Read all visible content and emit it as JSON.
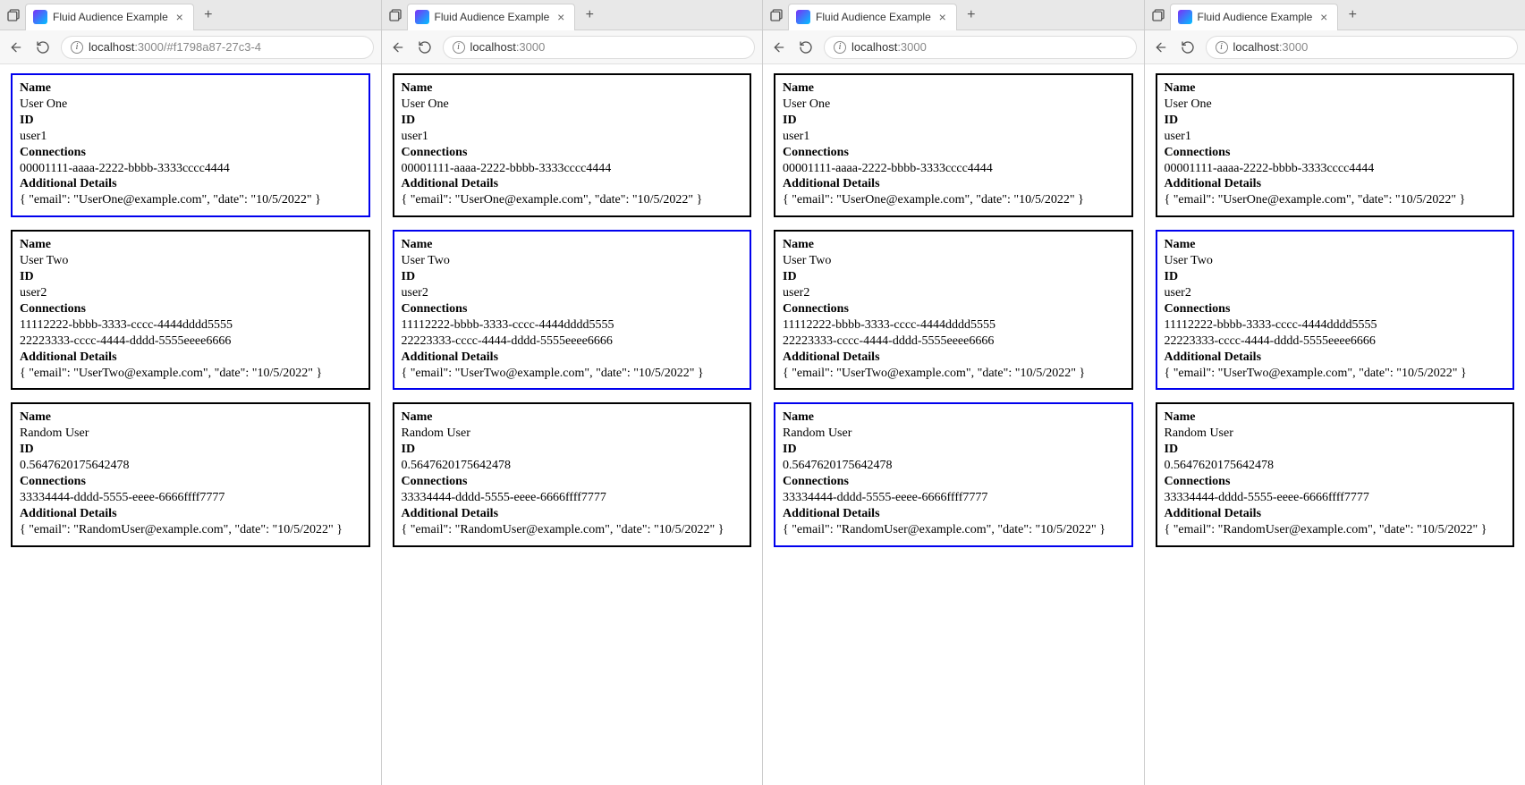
{
  "labels": {
    "name": "Name",
    "id": "ID",
    "connections": "Connections",
    "details": "Additional Details"
  },
  "users": [
    {
      "name": "User One",
      "id": "user1",
      "connections": [
        "00001111-aaaa-2222-bbbb-3333cccc4444"
      ],
      "details": "{ \"email\": \"UserOne@example.com\", \"date\": \"10/5/2022\" }"
    },
    {
      "name": "User Two",
      "id": "user2",
      "connections": [
        "11112222-bbbb-3333-cccc-4444dddd5555",
        "22223333-cccc-4444-dddd-5555eeee6666"
      ],
      "details": "{ \"email\": \"UserTwo@example.com\", \"date\": \"10/5/2022\" }"
    },
    {
      "name": "Random User",
      "id": "0.5647620175642478",
      "connections": [
        "33334444-dddd-5555-eeee-6666ffff7777"
      ],
      "details": "{ \"email\": \"RandomUser@example.com\", \"date\": \"10/5/2022\" }"
    }
  ],
  "windows": [
    {
      "tab_title": "Fluid Audience Example",
      "url_host": "localhost",
      "url_port": ":3000",
      "url_path": "/#f1798a87-27c3-4",
      "selected_card": 0
    },
    {
      "tab_title": "Fluid Audience Example",
      "url_host": "localhost",
      "url_port": ":3000",
      "url_path": "",
      "selected_card": 1
    },
    {
      "tab_title": "Fluid Audience Example",
      "url_host": "localhost",
      "url_port": ":3000",
      "url_path": "",
      "selected_card": 2
    },
    {
      "tab_title": "Fluid Audience Example",
      "url_host": "localhost",
      "url_port": ":3000",
      "url_path": "",
      "selected_card": 1
    }
  ]
}
